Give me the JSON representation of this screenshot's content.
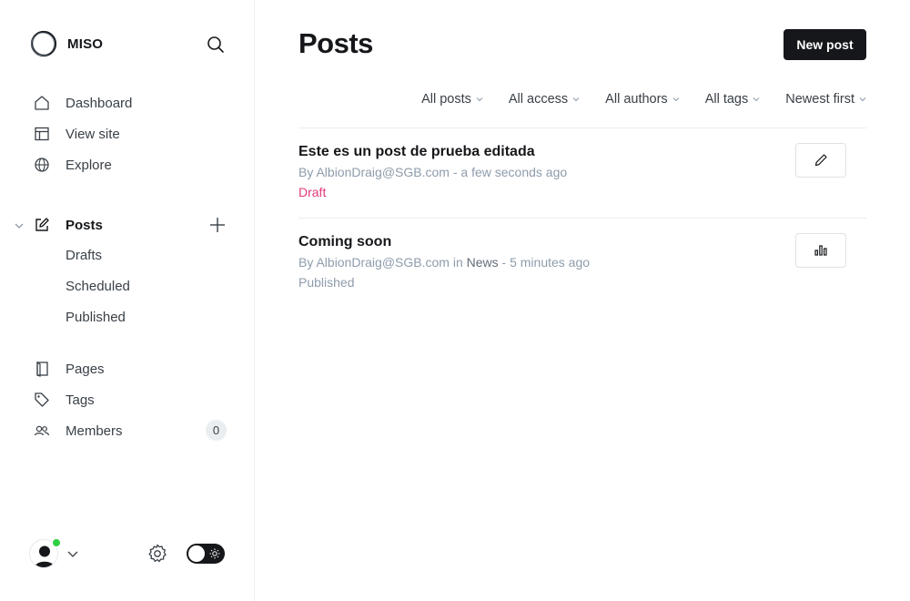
{
  "brand": {
    "name": "MISO",
    "logo_icon": "ring-logo-icon"
  },
  "sidebar": {
    "primary": [
      {
        "label": "Dashboard",
        "icon": "home-icon"
      },
      {
        "label": "View site",
        "icon": "layout-icon"
      },
      {
        "label": "Explore",
        "icon": "globe-icon"
      }
    ],
    "posts": {
      "label": "Posts",
      "icon": "edit-icon",
      "subitems": [
        {
          "label": "Drafts"
        },
        {
          "label": "Scheduled"
        },
        {
          "label": "Published"
        }
      ]
    },
    "secondary": [
      {
        "label": "Pages",
        "icon": "page-icon"
      },
      {
        "label": "Tags",
        "icon": "tag-icon"
      },
      {
        "label": "Members",
        "icon": "members-icon",
        "count": "0"
      }
    ]
  },
  "main": {
    "title": "Posts",
    "new_post_label": "New post",
    "filters": [
      {
        "label": "All posts"
      },
      {
        "label": "All access"
      },
      {
        "label": "All authors"
      },
      {
        "label": "All tags"
      },
      {
        "label": "Newest first"
      }
    ],
    "posts": [
      {
        "title": "Este es un post de prueba editada",
        "by": "By AlbionDraig@SGB.com",
        "time": " - a few seconds ago",
        "status": "Draft",
        "action_icon": "pencil-icon"
      },
      {
        "title": "Coming soon",
        "by": "By AlbionDraig@SGB.com",
        "in": " in ",
        "tag": "News",
        "time": " - 5 minutes ago",
        "status": "Published",
        "action_icon": "analytics-icon"
      }
    ]
  },
  "colors": {
    "accent_dark": "#15171a",
    "draft": "#e43a7b",
    "online": "#30cf43",
    "muted": "#8e9cac"
  }
}
